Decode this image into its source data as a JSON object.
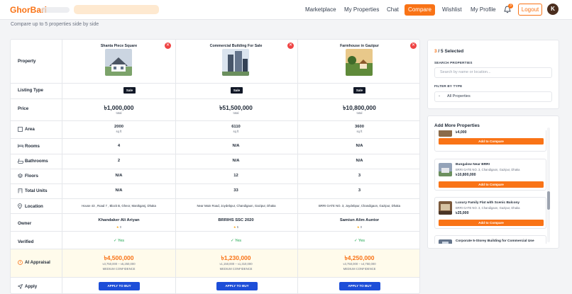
{
  "nav": {
    "logo": "GhorBari",
    "links": [
      "Marketplace",
      "My Properties",
      "Chat"
    ],
    "compare": "Compare",
    "links2": [
      "Wishlist",
      "My Profile"
    ],
    "notif_count": "3",
    "logout": "Logout",
    "avatar": "K",
    "accent": "#f97316"
  },
  "subtitle": "Compare up to 5 properties side by side",
  "table": {
    "labels": {
      "property": "Property",
      "listing": "Listing Type",
      "price": "Price",
      "area": "Area",
      "rooms": "Rooms",
      "bathrooms": "Bathrooms",
      "floors": "Floors",
      "units": "Total Units",
      "location": "Location",
      "owner": "Owner",
      "verified": "Verified",
      "appraisal": "AI Appraisal",
      "apply": "Apply"
    },
    "props": [
      {
        "name": "Shanta Piece Square",
        "listing": "Sale",
        "price": "৳1,000,000",
        "price_sub": "total",
        "area": "2000",
        "area_unit": "sq ft",
        "rooms": "4",
        "bathrooms": "2",
        "floors": "N/A",
        "units": "N/A",
        "location": "House 43 , Road 7 , Block B, Gheor, Manikganj, Dhaka",
        "owner": "Khandaker Ali Ariyan",
        "rating": "0",
        "verified": "Yes",
        "appraisal": "৳4,500,000",
        "range": "৳3,750,000 – ৳5,250,000",
        "confidence": "MEDIUM CONFIDENCE",
        "apply": "APPLY TO BUY"
      },
      {
        "name": "Commercial Building For Sale",
        "listing": "Sale",
        "price": "৳51,500,000",
        "price_sub": "total",
        "area": "6110",
        "area_unit": "sq ft",
        "rooms": "N/A",
        "bathrooms": "N/A",
        "floors": "12",
        "units": "33",
        "location": "Near Main Road, Joydebpur, Chandigaon, Gazipur, Dhaka",
        "owner": "BRRIHS SSC 2020",
        "rating": "5",
        "verified": "Yes",
        "appraisal": "৳1,230,000",
        "range": "৳1,150,000 – ৳1,310,000",
        "confidence": "MEDIUM CONFIDENCE",
        "apply": "APPLY TO BUY"
      },
      {
        "name": "Farmhouse in Gazipur",
        "listing": "Sale",
        "price": "৳10,800,000",
        "price_sub": "total",
        "area": "3600",
        "area_unit": "sq ft",
        "rooms": "N/A",
        "bathrooms": "N/A",
        "floors": "3",
        "units": "3",
        "location": "BRRI GATE NO. 3, Joydebpur, Chandigaon, Gazipur, Dhaka",
        "owner": "Samiun Alim Auntor",
        "rating": "0",
        "verified": "Yes",
        "appraisal": "৳4,250,000",
        "range": "৳3,750,000 – ৳4,750,000",
        "confidence": "MEDIUM CONFIDENCE",
        "apply": "APPLY TO BUY"
      }
    ]
  },
  "sidebar": {
    "count": "3",
    "count_suffix": " / 5 Selected",
    "search_label": "SEARCH PROPERTIES",
    "search_placeholder": "Search by name or location...",
    "filter_label": "FILTER BY TYPE",
    "filter_value": "All Properties",
    "add_title": "Add More Properties",
    "add_label": "Add to Compare",
    "items": [
      {
        "price": "৳4,000"
      },
      {
        "title": "Bungalow Near BRRI",
        "addr": "BRRI GATE NO. 3, Chandigaon, Gazipur, Dhaka",
        "price": "৳10,800,000"
      },
      {
        "title": "Luxury Family Flat with Scenic Balcony",
        "addr": "BRRI GATE NO. 3, Chandigaon, Gazipur, Dhaka",
        "price": "৳25,000"
      },
      {
        "title": "Corporate 5-Storey Building for Commercial Use"
      }
    ]
  }
}
